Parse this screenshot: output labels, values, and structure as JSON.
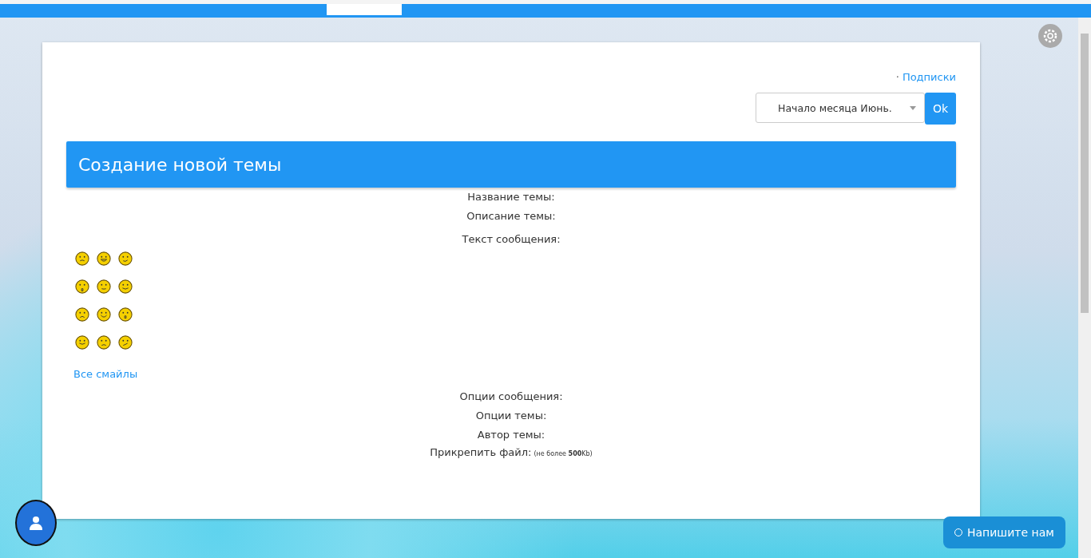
{
  "links": [
    {
      "bullet": "·",
      "label": "Подписки"
    }
  ],
  "period_select": {
    "value": "Начало месяца Июнь.",
    "button": "Ok"
  },
  "panel": {
    "title": "Создание новой темы"
  },
  "fields_top": [
    "Название темы:",
    "Описание темы:",
    "Текст сообщения:"
  ],
  "smileys": {
    "all_link": "Все смайлы"
  },
  "fields_bottom": [
    "Опции сообщения:",
    "Опции темы:",
    "Автор темы:"
  ],
  "attach": {
    "label": "Прикрепить файл:",
    "hint": "(не более **500**Kb)"
  },
  "chat_button": "Напишите нам"
}
